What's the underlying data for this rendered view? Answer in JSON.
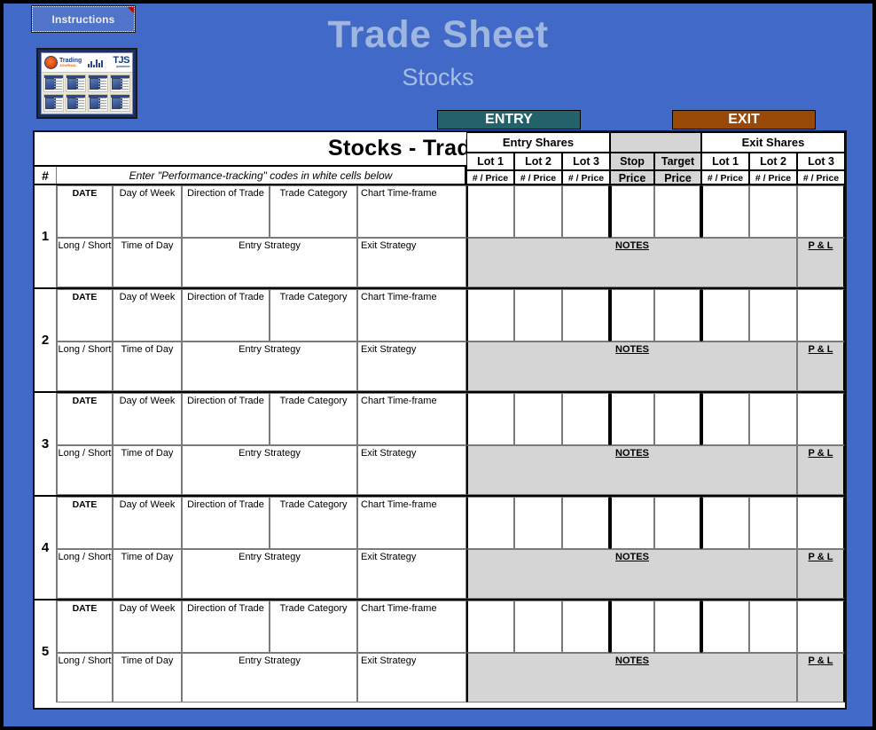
{
  "window": {
    "background_color": "#4069C8",
    "frame_color": "#000000"
  },
  "toolbar": {
    "instructions_label": "Instructions"
  },
  "logo": {
    "brand": "Trading",
    "brand_sub": "JOURNAL",
    "abbrev": "TJS",
    "abbrev_sub": "the Trading Journal Spreadsheet"
  },
  "header": {
    "title": "Trade Sheet",
    "subtitle": "Stocks"
  },
  "sheet": {
    "title": "Stocks - Trade Sheet",
    "hash_symbol": "#",
    "instruction": "Enter \"Performance-tracking\" codes in white cells below"
  },
  "entry": {
    "band_label": "ENTRY",
    "band_color": "#23626B",
    "shares_label": "Entry  Shares",
    "lots": [
      "Lot 1",
      "Lot 2",
      "Lot 3"
    ],
    "lot_sub": [
      "# / Price",
      "# / Price",
      "# / Price"
    ]
  },
  "middle": {
    "stop": {
      "label": "Stop",
      "sub": "Price"
    },
    "target": {
      "label": "Target",
      "sub": "Price"
    },
    "fill_color": "#D5D5D5"
  },
  "exit": {
    "band_label": "EXIT",
    "band_color": "#984807",
    "shares_label": "Exit  Shares",
    "lots": [
      "Lot 1",
      "Lot 2",
      "Lot 3"
    ],
    "lot_sub": [
      "# / Price",
      "# / Price",
      "# / Price"
    ]
  },
  "row_labels": {
    "top": [
      "DATE",
      "Day of Week",
      "Direction of Trade",
      "Trade Category",
      "Chart Time-frame"
    ],
    "bottom": [
      "Long / Short",
      "Time of Day",
      "Entry Strategy",
      "Exit Strategy"
    ],
    "notes": "NOTES",
    "pl": "P & L"
  },
  "rows": [
    {
      "number": "1"
    },
    {
      "number": "2"
    },
    {
      "number": "3"
    },
    {
      "number": "4"
    },
    {
      "number": "5"
    }
  ]
}
